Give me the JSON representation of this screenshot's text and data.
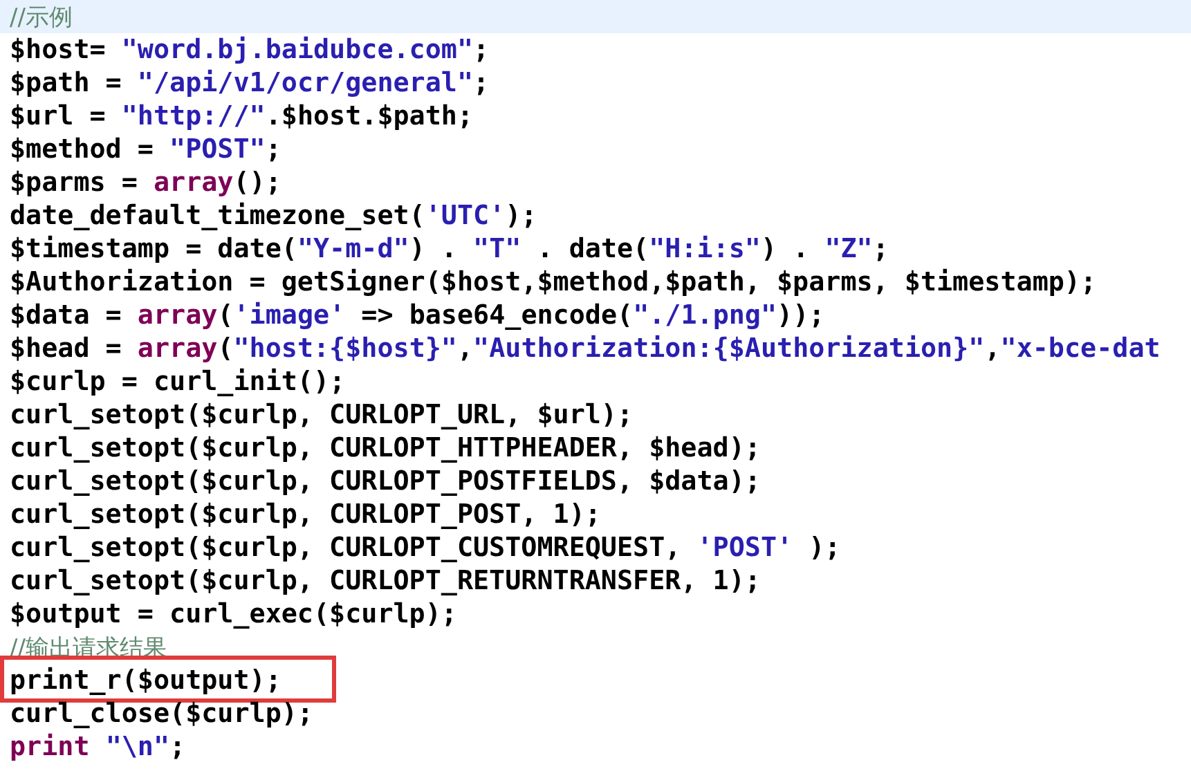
{
  "lines": [
    {
      "current": true,
      "boxed": false,
      "tokens": [
        {
          "kind": "comment",
          "text": "//示例"
        }
      ]
    },
    {
      "current": false,
      "boxed": false,
      "tokens": [
        {
          "kind": "plain",
          "text": "$host= "
        },
        {
          "kind": "string",
          "text": "\"word.bj.baidubce.com\""
        },
        {
          "kind": "plain",
          "text": ";"
        }
      ]
    },
    {
      "current": false,
      "boxed": false,
      "tokens": [
        {
          "kind": "plain",
          "text": "$path = "
        },
        {
          "kind": "string",
          "text": "\"/api/v1/ocr/general\""
        },
        {
          "kind": "plain",
          "text": ";"
        }
      ]
    },
    {
      "current": false,
      "boxed": false,
      "tokens": [
        {
          "kind": "plain",
          "text": "$url = "
        },
        {
          "kind": "string",
          "text": "\"http://\""
        },
        {
          "kind": "plain",
          "text": ".$host.$path;"
        }
      ]
    },
    {
      "current": false,
      "boxed": false,
      "tokens": [
        {
          "kind": "plain",
          "text": "$method = "
        },
        {
          "kind": "string",
          "text": "\"POST\""
        },
        {
          "kind": "plain",
          "text": ";"
        }
      ]
    },
    {
      "current": false,
      "boxed": false,
      "tokens": [
        {
          "kind": "plain",
          "text": "$parms = "
        },
        {
          "kind": "keyword",
          "text": "array"
        },
        {
          "kind": "plain",
          "text": "();"
        }
      ]
    },
    {
      "current": false,
      "boxed": false,
      "tokens": [
        {
          "kind": "plain",
          "text": "date_default_timezone_set("
        },
        {
          "kind": "string",
          "text": "'UTC'"
        },
        {
          "kind": "plain",
          "text": ");"
        }
      ]
    },
    {
      "current": false,
      "boxed": false,
      "tokens": [
        {
          "kind": "plain",
          "text": "$timestamp = date("
        },
        {
          "kind": "string",
          "text": "\"Y-m-d\""
        },
        {
          "kind": "plain",
          "text": ") . "
        },
        {
          "kind": "string",
          "text": "\"T\""
        },
        {
          "kind": "plain",
          "text": " . date("
        },
        {
          "kind": "string",
          "text": "\"H:i:s\""
        },
        {
          "kind": "plain",
          "text": ") . "
        },
        {
          "kind": "string",
          "text": "\"Z\""
        },
        {
          "kind": "plain",
          "text": ";"
        }
      ]
    },
    {
      "current": false,
      "boxed": false,
      "tokens": [
        {
          "kind": "plain",
          "text": "$Authorization = getSigner($host,$method,$path, $parms, $timestamp);"
        }
      ]
    },
    {
      "current": false,
      "boxed": false,
      "tokens": [
        {
          "kind": "plain",
          "text": "$data = "
        },
        {
          "kind": "keyword",
          "text": "array"
        },
        {
          "kind": "plain",
          "text": "("
        },
        {
          "kind": "string",
          "text": "'image'"
        },
        {
          "kind": "plain",
          "text": " => base64_encode("
        },
        {
          "kind": "string",
          "text": "\"./1.png\""
        },
        {
          "kind": "plain",
          "text": "));"
        }
      ]
    },
    {
      "current": false,
      "boxed": false,
      "tokens": [
        {
          "kind": "plain",
          "text": "$head = "
        },
        {
          "kind": "keyword",
          "text": "array"
        },
        {
          "kind": "plain",
          "text": "("
        },
        {
          "kind": "string",
          "text": "\"host:{$host}\""
        },
        {
          "kind": "plain",
          "text": ","
        },
        {
          "kind": "string",
          "text": "\"Authorization:{$Authorization}\""
        },
        {
          "kind": "plain",
          "text": ","
        },
        {
          "kind": "string",
          "text": "\"x-bce-dat"
        }
      ]
    },
    {
      "current": false,
      "boxed": false,
      "tokens": [
        {
          "kind": "plain",
          "text": "$curlp = curl_init();"
        }
      ]
    },
    {
      "current": false,
      "boxed": false,
      "tokens": [
        {
          "kind": "plain",
          "text": "curl_setopt($curlp, CURLOPT_URL, $url);"
        }
      ]
    },
    {
      "current": false,
      "boxed": false,
      "tokens": [
        {
          "kind": "plain",
          "text": "curl_setopt($curlp, CURLOPT_HTTPHEADER, $head);"
        }
      ]
    },
    {
      "current": false,
      "boxed": false,
      "tokens": [
        {
          "kind": "plain",
          "text": "curl_setopt($curlp, CURLOPT_POSTFIELDS, $data);"
        }
      ]
    },
    {
      "current": false,
      "boxed": false,
      "tokens": [
        {
          "kind": "plain",
          "text": "curl_setopt($curlp, CURLOPT_POST, 1);"
        }
      ]
    },
    {
      "current": false,
      "boxed": false,
      "tokens": [
        {
          "kind": "plain",
          "text": "curl_setopt($curlp, CURLOPT_CUSTOMREQUEST, "
        },
        {
          "kind": "string",
          "text": "'POST'"
        },
        {
          "kind": "plain",
          "text": " );"
        }
      ]
    },
    {
      "current": false,
      "boxed": false,
      "tokens": [
        {
          "kind": "plain",
          "text": "curl_setopt($curlp, CURLOPT_RETURNTRANSFER, 1);"
        }
      ]
    },
    {
      "current": false,
      "boxed": false,
      "tokens": [
        {
          "kind": "plain",
          "text": "$output = curl_exec($curlp);"
        }
      ]
    },
    {
      "current": false,
      "boxed": false,
      "tokens": [
        {
          "kind": "comment",
          "text": "//输出请求结果"
        }
      ]
    },
    {
      "current": false,
      "boxed": true,
      "tokens": [
        {
          "kind": "plain",
          "text": "print_r($output);"
        }
      ]
    },
    {
      "current": false,
      "boxed": false,
      "tokens": [
        {
          "kind": "plain",
          "text": "curl_close($curlp);"
        }
      ]
    },
    {
      "current": false,
      "boxed": false,
      "tokens": [
        {
          "kind": "keyword",
          "text": "print"
        },
        {
          "kind": "string",
          "text": " \"\\n\""
        },
        {
          "kind": "plain",
          "text": ";"
        }
      ]
    }
  ]
}
